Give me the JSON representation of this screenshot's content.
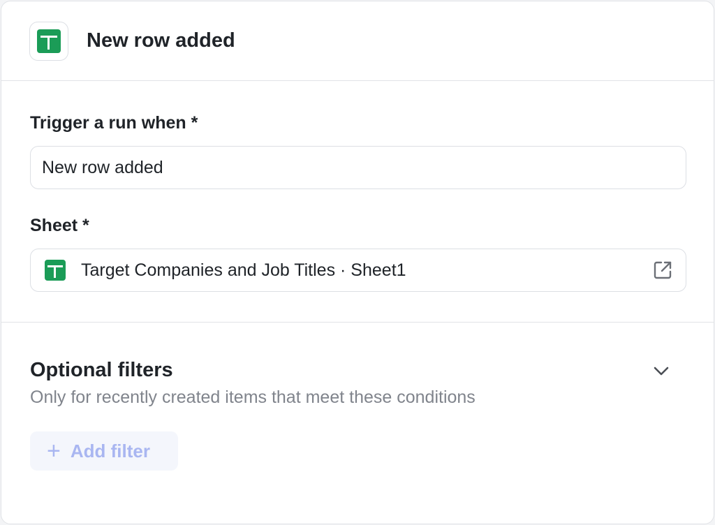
{
  "header": {
    "title": "New row added",
    "app_icon": "google-sheets-icon"
  },
  "trigger": {
    "label": "Trigger a run when *",
    "value": "New row added"
  },
  "sheet": {
    "label": "Sheet *",
    "value": "Target Companies and Job Titles · Sheet1",
    "icon": "google-sheets-icon",
    "action_icon": "external-link-icon"
  },
  "filters": {
    "title": "Optional filters",
    "subtitle": "Only for recently created items that meet these conditions",
    "add_label": "Add filter",
    "add_icon": "plus-icon",
    "toggle_icon": "chevron-down-icon"
  },
  "colors": {
    "sheets_green": "#1b9c57",
    "accent_disabled": "#a9b6f1",
    "text_primary": "#1f2328",
    "text_muted": "#80848c",
    "border": "#dcdfe4"
  }
}
